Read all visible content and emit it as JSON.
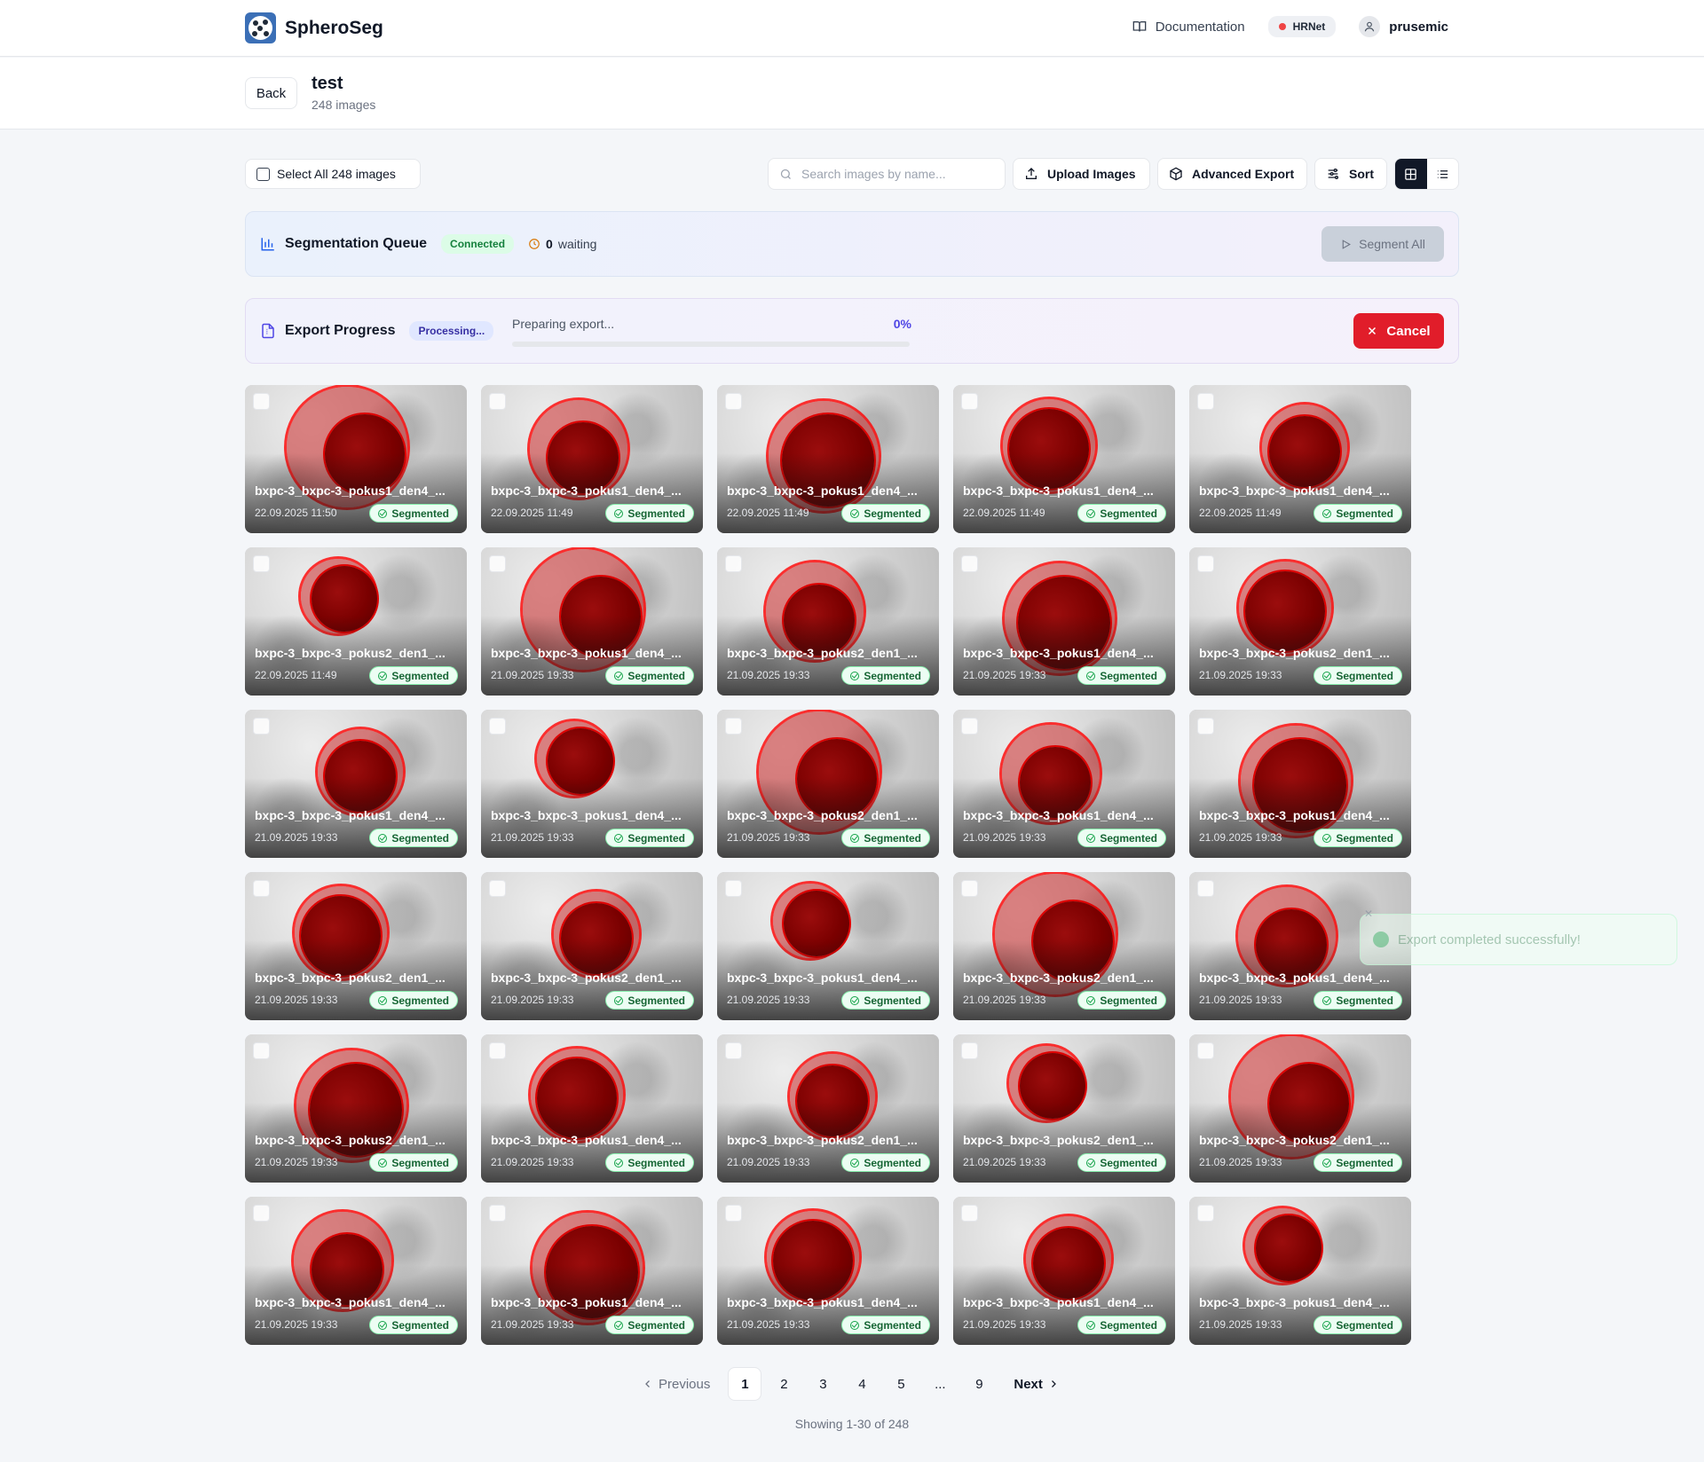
{
  "app": {
    "name": "SpheroSeg",
    "nav": {
      "documentation": "Documentation",
      "model": "HRNet",
      "user": "prusemic"
    }
  },
  "project": {
    "back_label": "Back",
    "title": "test",
    "subtitle": "248 images"
  },
  "toolbar": {
    "select_all": "Select All 248 images",
    "search_placeholder": "Search images by name...",
    "upload": "Upload Images",
    "advanced_export": "Advanced Export",
    "sort": "Sort"
  },
  "queue": {
    "title": "Segmentation Queue",
    "status": "Connected",
    "waiting_count": "0",
    "waiting_label": "waiting",
    "segment_all": "Segment All"
  },
  "export": {
    "title": "Export Progress",
    "status": "Processing...",
    "message": "Preparing export...",
    "percent": "0%",
    "progress_fraction": 0,
    "cancel": "Cancel"
  },
  "images": [
    {
      "name": "bxpc-3_bxpc-3_pokus1_den4_...",
      "date": "22.09.2025 11:50",
      "status": "Segmented"
    },
    {
      "name": "bxpc-3_bxpc-3_pokus1_den4_...",
      "date": "22.09.2025 11:49",
      "status": "Segmented"
    },
    {
      "name": "bxpc-3_bxpc-3_pokus1_den4_...",
      "date": "22.09.2025 11:49",
      "status": "Segmented"
    },
    {
      "name": "bxpc-3_bxpc-3_pokus1_den4_...",
      "date": "22.09.2025 11:49",
      "status": "Segmented"
    },
    {
      "name": "bxpc-3_bxpc-3_pokus1_den4_...",
      "date": "22.09.2025 11:49",
      "status": "Segmented"
    },
    {
      "name": "bxpc-3_bxpc-3_pokus2_den1_...",
      "date": "22.09.2025 11:49",
      "status": "Segmented"
    },
    {
      "name": "bxpc-3_bxpc-3_pokus1_den4_...",
      "date": "21.09.2025 19:33",
      "status": "Segmented"
    },
    {
      "name": "bxpc-3_bxpc-3_pokus2_den1_...",
      "date": "21.09.2025 19:33",
      "status": "Segmented"
    },
    {
      "name": "bxpc-3_bxpc-3_pokus1_den4_...",
      "date": "21.09.2025 19:33",
      "status": "Segmented"
    },
    {
      "name": "bxpc-3_bxpc-3_pokus2_den1_...",
      "date": "21.09.2025 19:33",
      "status": "Segmented"
    },
    {
      "name": "bxpc-3_bxpc-3_pokus1_den4_...",
      "date": "21.09.2025 19:33",
      "status": "Segmented"
    },
    {
      "name": "bxpc-3_bxpc-3_pokus1_den4_...",
      "date": "21.09.2025 19:33",
      "status": "Segmented"
    },
    {
      "name": "bxpc-3_bxpc-3_pokus2_den1_...",
      "date": "21.09.2025 19:33",
      "status": "Segmented"
    },
    {
      "name": "bxpc-3_bxpc-3_pokus1_den4_...",
      "date": "21.09.2025 19:33",
      "status": "Segmented"
    },
    {
      "name": "bxpc-3_bxpc-3_pokus1_den4_...",
      "date": "21.09.2025 19:33",
      "status": "Segmented"
    },
    {
      "name": "bxpc-3_bxpc-3_pokus2_den1_...",
      "date": "21.09.2025 19:33",
      "status": "Segmented"
    },
    {
      "name": "bxpc-3_bxpc-3_pokus2_den1_...",
      "date": "21.09.2025 19:33",
      "status": "Segmented"
    },
    {
      "name": "bxpc-3_bxpc-3_pokus1_den4_...",
      "date": "21.09.2025 19:33",
      "status": "Segmented"
    },
    {
      "name": "bxpc-3_bxpc-3_pokus2_den1_...",
      "date": "21.09.2025 19:33",
      "status": "Segmented"
    },
    {
      "name": "bxpc-3_bxpc-3_pokus1_den4_...",
      "date": "21.09.2025 19:33",
      "status": "Segmented"
    },
    {
      "name": "bxpc-3_bxpc-3_pokus2_den1_...",
      "date": "21.09.2025 19:33",
      "status": "Segmented"
    },
    {
      "name": "bxpc-3_bxpc-3_pokus1_den4_...",
      "date": "21.09.2025 19:33",
      "status": "Segmented"
    },
    {
      "name": "bxpc-3_bxpc-3_pokus2_den1_...",
      "date": "21.09.2025 19:33",
      "status": "Segmented"
    },
    {
      "name": "bxpc-3_bxpc-3_pokus2_den1_...",
      "date": "21.09.2025 19:33",
      "status": "Segmented"
    },
    {
      "name": "bxpc-3_bxpc-3_pokus2_den1_...",
      "date": "21.09.2025 19:33",
      "status": "Segmented"
    },
    {
      "name": "bxpc-3_bxpc-3_pokus1_den4_...",
      "date": "21.09.2025 19:33",
      "status": "Segmented"
    },
    {
      "name": "bxpc-3_bxpc-3_pokus1_den4_...",
      "date": "21.09.2025 19:33",
      "status": "Segmented"
    },
    {
      "name": "bxpc-3_bxpc-3_pokus1_den4_...",
      "date": "21.09.2025 19:33",
      "status": "Segmented"
    },
    {
      "name": "bxpc-3_bxpc-3_pokus1_den4_...",
      "date": "21.09.2025 19:33",
      "status": "Segmented"
    },
    {
      "name": "bxpc-3_bxpc-3_pokus1_den4_...",
      "date": "21.09.2025 19:33",
      "status": "Segmented"
    }
  ],
  "toast": {
    "message": "Export completed successfully!"
  },
  "pagination": {
    "previous": "Previous",
    "pages": [
      "1",
      "2",
      "3",
      "4",
      "5",
      "...",
      "9"
    ],
    "current": "1",
    "next": "Next",
    "showing": "Showing 1-30 of 248"
  },
  "colors": {
    "accent": "#4f46e5",
    "danger": "#e11d2a",
    "success": "#16a34a",
    "mask": "#8b0000"
  }
}
